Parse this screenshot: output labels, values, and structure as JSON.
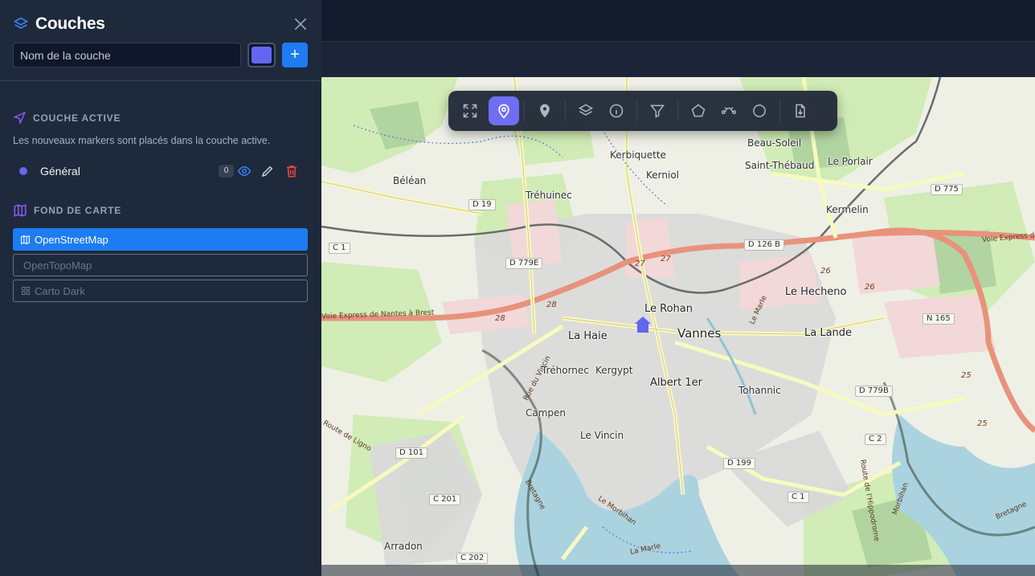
{
  "sidebar": {
    "title": "Couches",
    "layer_name_placeholder": "Nom de la couche",
    "color": "#6366f1",
    "add_label": "+",
    "active_section": {
      "heading": "COUCHE ACTIVE",
      "hint": "Les nouveaux markers sont placés dans la couche active."
    },
    "layers": [
      {
        "name": "Général",
        "count": "0",
        "color": "#6366f1"
      }
    ],
    "basemap_section": {
      "heading": "FOND DE CARTE",
      "options": [
        {
          "label": "OpenStreetMap",
          "selected": true
        },
        {
          "label": "OpenTopoMap",
          "selected": false
        },
        {
          "label": "Carto Dark",
          "selected": false
        }
      ]
    }
  },
  "toolbar": {
    "buttons": [
      "fullscreen-icon",
      "map-pin-icon",
      "location-icon",
      "layers-icon",
      "info-icon",
      "filter-icon",
      "polygon-icon",
      "polyline-icon",
      "circle-icon",
      "export-icon"
    ],
    "active": "map-pin-icon"
  },
  "map": {
    "places": [
      "Kerbiquette",
      "Kerniol",
      "Beau-Soleil",
      "Saint-Thébaud",
      "Le Porlair",
      "Béléan",
      "Tréhuinec",
      "Kermelin",
      "Le Rohan",
      "Vannes",
      "Le Hecheno",
      "La Haie",
      "La Lande",
      "Tréhornec",
      "Kergypt",
      "Albert 1er",
      "Tohannic",
      "Campen",
      "Le Vincin",
      "Arradon"
    ],
    "roads": [
      "D 19",
      "C 1",
      "D 779E",
      "D 126 B",
      "D 775",
      "N 165",
      "D 779B",
      "C 2",
      "D 101",
      "D 199",
      "C 1",
      "C 201",
      "C 202"
    ],
    "road_texts": [
      "Voie Express de Nantes à Brest",
      "Voie Express de",
      "Rue du Vincin",
      "Route de Ligno",
      "Route de l'Hippodrome",
      "Le Morbihan",
      "Morbihan",
      "Bretagne",
      "Bretagne",
      "Le Marle",
      "La Marle"
    ],
    "road_numbers": [
      "27",
      "27",
      "28",
      "28",
      "26",
      "26",
      "25",
      "25"
    ]
  }
}
